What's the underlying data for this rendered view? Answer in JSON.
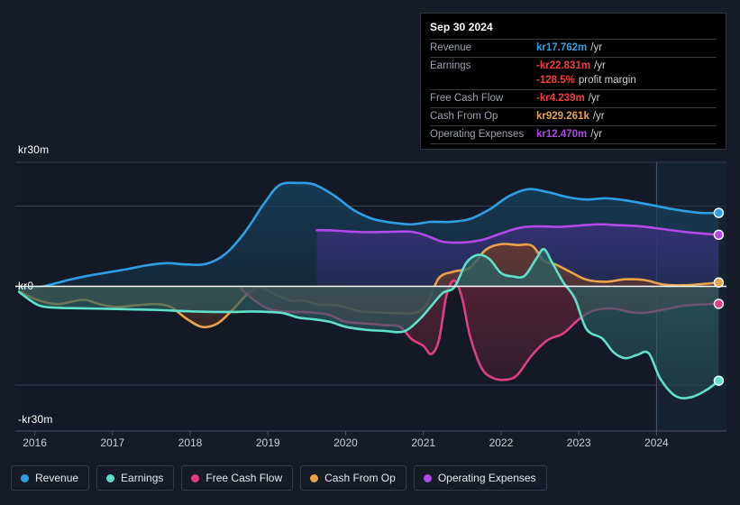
{
  "chart_data": {
    "type": "area",
    "title": "",
    "xlabel": "",
    "ylabel": "",
    "currency_prefix": "kr",
    "ylim": [
      -30,
      30
    ],
    "y_ticks": [
      {
        "label": "kr30m",
        "value": 30
      },
      {
        "label": "kr0",
        "value": 0
      },
      {
        "label": "-kr30m",
        "value": -30
      }
    ],
    "x_ticks": [
      "2016",
      "2017",
      "2018",
      "2019",
      "2020",
      "2021",
      "2022",
      "2023",
      "2024"
    ],
    "x_range": [
      2015.75,
      2024.9
    ],
    "grid": true,
    "legend_position": "bottom",
    "forecast_divider_x": 2024.0,
    "series": [
      {
        "name": "Revenue",
        "color": "#2f9fe3",
        "fill": "#17405c",
        "end_value": 17.762,
        "points": [
          [
            2015.8,
            -0.6
          ],
          [
            2016.0,
            -0.4
          ],
          [
            2016.2,
            0.4
          ],
          [
            2016.45,
            1.6
          ],
          [
            2016.7,
            2.6
          ],
          [
            2016.95,
            3.4
          ],
          [
            2017.2,
            4.2
          ],
          [
            2017.45,
            5.1
          ],
          [
            2017.7,
            5.6
          ],
          [
            2017.95,
            5.3
          ],
          [
            2018.2,
            5.4
          ],
          [
            2018.45,
            7.8
          ],
          [
            2018.7,
            13.0
          ],
          [
            2018.95,
            20.0
          ],
          [
            2019.15,
            24.5
          ],
          [
            2019.4,
            25.0
          ],
          [
            2019.6,
            24.6
          ],
          [
            2019.85,
            22.0
          ],
          [
            2020.1,
            18.5
          ],
          [
            2020.35,
            16.3
          ],
          [
            2020.6,
            15.4
          ],
          [
            2020.85,
            15.0
          ],
          [
            2021.1,
            15.6
          ],
          [
            2021.35,
            15.6
          ],
          [
            2021.6,
            16.3
          ],
          [
            2021.85,
            18.6
          ],
          [
            2022.1,
            21.8
          ],
          [
            2022.35,
            23.5
          ],
          [
            2022.6,
            22.8
          ],
          [
            2022.85,
            21.6
          ],
          [
            2023.1,
            21.0
          ],
          [
            2023.35,
            21.3
          ],
          [
            2023.6,
            20.8
          ],
          [
            2023.9,
            19.8
          ],
          [
            2024.2,
            18.7
          ],
          [
            2024.55,
            17.8
          ],
          [
            2024.8,
            17.762
          ]
        ]
      },
      {
        "name": "Operating Expenses",
        "color": "#b14ae8",
        "fill": "#3a2f7a",
        "end_value": 12.47,
        "start_x": 2019.63,
        "points": [
          [
            2019.63,
            13.6
          ],
          [
            2019.85,
            13.5
          ],
          [
            2020.1,
            13.2
          ],
          [
            2020.35,
            13.1
          ],
          [
            2020.6,
            13.2
          ],
          [
            2020.85,
            13.2
          ],
          [
            2021.05,
            12.2
          ],
          [
            2021.25,
            10.8
          ],
          [
            2021.5,
            10.6
          ],
          [
            2021.75,
            11.2
          ],
          [
            2022.0,
            12.8
          ],
          [
            2022.25,
            14.2
          ],
          [
            2022.5,
            14.5
          ],
          [
            2022.75,
            14.4
          ],
          [
            2023.0,
            14.7
          ],
          [
            2023.25,
            15.0
          ],
          [
            2023.5,
            14.8
          ],
          [
            2023.8,
            14.5
          ],
          [
            2024.1,
            13.8
          ],
          [
            2024.45,
            13.0
          ],
          [
            2024.8,
            12.47
          ]
        ]
      },
      {
        "name": "Cash From Op",
        "color": "#e8a34a",
        "fill": "#6b3a28",
        "end_value": 0.929,
        "points": [
          [
            2015.8,
            -1.2
          ],
          [
            2016.05,
            -3.4
          ],
          [
            2016.3,
            -4.3
          ],
          [
            2016.5,
            -3.6
          ],
          [
            2016.65,
            -3.3
          ],
          [
            2016.85,
            -4.4
          ],
          [
            2017.05,
            -5.0
          ],
          [
            2017.3,
            -4.6
          ],
          [
            2017.55,
            -4.3
          ],
          [
            2017.75,
            -5.0
          ],
          [
            2017.95,
            -7.8
          ],
          [
            2018.15,
            -9.8
          ],
          [
            2018.35,
            -9.0
          ],
          [
            2018.55,
            -5.6
          ],
          [
            2018.75,
            -1.6
          ],
          [
            2018.9,
            -0.2
          ],
          [
            2019.1,
            -2.0
          ],
          [
            2019.3,
            -3.5
          ],
          [
            2019.45,
            -3.4
          ],
          [
            2019.65,
            -4.4
          ],
          [
            2019.9,
            -4.6
          ],
          [
            2020.15,
            -5.9
          ],
          [
            2020.4,
            -6.3
          ],
          [
            2020.7,
            -6.5
          ],
          [
            2020.9,
            -6.4
          ],
          [
            2021.05,
            -4.2
          ],
          [
            2021.2,
            2.0
          ],
          [
            2021.4,
            3.6
          ],
          [
            2021.6,
            4.5
          ],
          [
            2021.8,
            8.8
          ],
          [
            2022.0,
            10.2
          ],
          [
            2022.2,
            10.0
          ],
          [
            2022.4,
            9.8
          ],
          [
            2022.55,
            6.2
          ],
          [
            2022.7,
            5.3
          ],
          [
            2022.9,
            3.4
          ],
          [
            2023.1,
            1.6
          ],
          [
            2023.35,
            1.1
          ],
          [
            2023.6,
            1.7
          ],
          [
            2023.85,
            1.5
          ],
          [
            2024.1,
            0.4
          ],
          [
            2024.4,
            0.3
          ],
          [
            2024.8,
            0.929
          ]
        ]
      },
      {
        "name": "Free Cash Flow",
        "color": "#de3f83",
        "fill": "#5e2438",
        "end_value": -4.239,
        "start_x": 2018.65,
        "points": [
          [
            2018.65,
            -0.5
          ],
          [
            2018.8,
            -3.0
          ],
          [
            2019.0,
            -5.4
          ],
          [
            2019.2,
            -6.1
          ],
          [
            2019.4,
            -6.2
          ],
          [
            2019.6,
            -6.4
          ],
          [
            2019.8,
            -7.0
          ],
          [
            2020.0,
            -8.6
          ],
          [
            2020.25,
            -9.0
          ],
          [
            2020.5,
            -9.4
          ],
          [
            2020.7,
            -9.8
          ],
          [
            2020.85,
            -12.8
          ],
          [
            2021.0,
            -14.4
          ],
          [
            2021.1,
            -16.4
          ],
          [
            2021.2,
            -13.0
          ],
          [
            2021.3,
            -2.0
          ],
          [
            2021.4,
            1.4
          ],
          [
            2021.5,
            -3.0
          ],
          [
            2021.6,
            -12.0
          ],
          [
            2021.75,
            -19.8
          ],
          [
            2021.9,
            -22.2
          ],
          [
            2022.05,
            -22.6
          ],
          [
            2022.2,
            -21.6
          ],
          [
            2022.4,
            -16.6
          ],
          [
            2022.6,
            -13.0
          ],
          [
            2022.8,
            -11.4
          ],
          [
            2023.0,
            -8.0
          ],
          [
            2023.2,
            -5.8
          ],
          [
            2023.45,
            -5.4
          ],
          [
            2023.65,
            -6.2
          ],
          [
            2023.85,
            -6.4
          ],
          [
            2024.1,
            -5.6
          ],
          [
            2024.4,
            -4.6
          ],
          [
            2024.8,
            -4.239
          ]
        ]
      },
      {
        "name": "Earnings",
        "color": "#5fe0c8",
        "fill": "#2c5f60",
        "end_value": -22.831,
        "points": [
          [
            2015.8,
            -1.4
          ],
          [
            2016.05,
            -4.6
          ],
          [
            2016.3,
            -5.2
          ],
          [
            2016.55,
            -5.3
          ],
          [
            2016.8,
            -5.4
          ],
          [
            2017.05,
            -5.5
          ],
          [
            2017.3,
            -5.6
          ],
          [
            2017.55,
            -5.7
          ],
          [
            2017.8,
            -5.9
          ],
          [
            2018.05,
            -6.1
          ],
          [
            2018.3,
            -6.2
          ],
          [
            2018.55,
            -6.2
          ],
          [
            2018.8,
            -6.1
          ],
          [
            2019.0,
            -6.2
          ],
          [
            2019.2,
            -6.5
          ],
          [
            2019.4,
            -7.6
          ],
          [
            2019.6,
            -8.0
          ],
          [
            2019.8,
            -8.6
          ],
          [
            2020.0,
            -9.8
          ],
          [
            2020.25,
            -10.5
          ],
          [
            2020.5,
            -10.8
          ],
          [
            2020.75,
            -10.9
          ],
          [
            2020.95,
            -8.0
          ],
          [
            2021.1,
            -4.8
          ],
          [
            2021.25,
            -1.6
          ],
          [
            2021.4,
            -0.2
          ],
          [
            2021.55,
            5.6
          ],
          [
            2021.7,
            7.6
          ],
          [
            2021.85,
            6.6
          ],
          [
            2022.0,
            3.2
          ],
          [
            2022.15,
            2.4
          ],
          [
            2022.3,
            2.5
          ],
          [
            2022.45,
            6.6
          ],
          [
            2022.55,
            9.0
          ],
          [
            2022.65,
            6.0
          ],
          [
            2022.8,
            1.0
          ],
          [
            2022.95,
            -3.0
          ],
          [
            2023.1,
            -10.4
          ],
          [
            2023.3,
            -12.6
          ],
          [
            2023.45,
            -16.0
          ],
          [
            2023.6,
            -17.4
          ],
          [
            2023.75,
            -16.6
          ],
          [
            2023.9,
            -16.2
          ],
          [
            2024.05,
            -22.4
          ],
          [
            2024.25,
            -26.6
          ],
          [
            2024.45,
            -26.8
          ],
          [
            2024.65,
            -25.0
          ],
          [
            2024.8,
            -22.831
          ]
        ]
      }
    ]
  },
  "tooltip": {
    "date": "Sep 30 2024",
    "rows": [
      {
        "label": "Revenue",
        "value": "kr17.762m",
        "unit": "/yr",
        "color": "#2f9fe3"
      },
      {
        "label": "Earnings",
        "value": "-kr22.831m",
        "unit": "/yr",
        "color": "#f23f3f"
      },
      {
        "label": "",
        "value": "-128.5%",
        "unit": "profit margin",
        "color": "#f23f3f"
      },
      {
        "label": "Free Cash Flow",
        "value": "-kr4.239m",
        "unit": "/yr",
        "color": "#f23f3f"
      },
      {
        "label": "Cash From Op",
        "value": "kr929.261k",
        "unit": "/yr",
        "color": "#e8a34a"
      },
      {
        "label": "Operating Expenses",
        "value": "kr12.470m",
        "unit": "/yr",
        "color": "#b14ae8"
      }
    ]
  },
  "legend": {
    "items": [
      {
        "label": "Revenue",
        "color": "#2f9fe3"
      },
      {
        "label": "Earnings",
        "color": "#5fe0c8"
      },
      {
        "label": "Free Cash Flow",
        "color": "#de3f83"
      },
      {
        "label": "Cash From Op",
        "color": "#e8a34a"
      },
      {
        "label": "Operating Expenses",
        "color": "#b14ae8"
      }
    ]
  }
}
